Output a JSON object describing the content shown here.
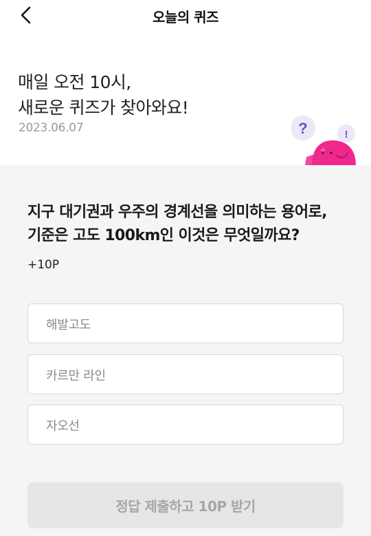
{
  "header": {
    "title": "오늘의 퀴즈",
    "back_icon": "chevron-left-icon"
  },
  "hero": {
    "line1": "매일 오전 10시,",
    "line2": "새로운 퀴즈가 찾아와요!",
    "date": "2023.06.07",
    "mascot_question_mark": "?",
    "mascot_exclamation": "!"
  },
  "quiz": {
    "question_line1": "지구 대기권과 우주의 경계선을 의미하는 용어로,",
    "question_line2": "기준은 고도 100km인 이것은 무엇일까요?",
    "points": "+10P",
    "options": [
      {
        "label": "해발고도"
      },
      {
        "label": "카르만 라인"
      },
      {
        "label": "자오선"
      }
    ],
    "submit_label": "정답 제출하고 10P 받기"
  },
  "colors": {
    "accent_pink": "#f0288c",
    "accent_purple": "#6a4fc8",
    "background_gray": "#f5f5f5",
    "disabled_button": "#e6e6e6",
    "disabled_text": "#a6a6a6"
  }
}
